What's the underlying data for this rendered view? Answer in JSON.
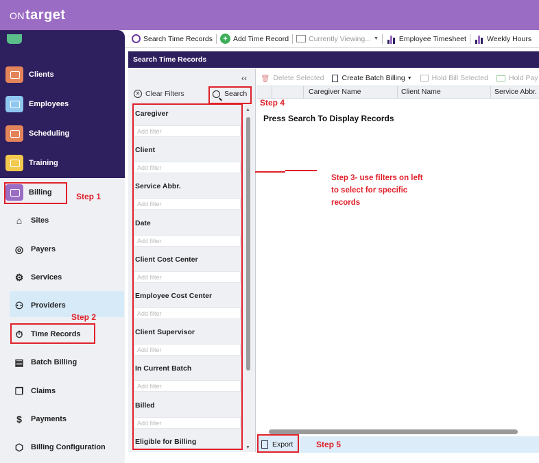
{
  "app": {
    "logo_prefix": "ON",
    "logo_main": "target"
  },
  "sidebar": {
    "dark_items": [
      {
        "label": "Clients",
        "color": "#e4845b"
      },
      {
        "label": "Employees",
        "color": "#8fc7f0"
      },
      {
        "label": "Scheduling",
        "color": "#e4845b"
      },
      {
        "label": "Training",
        "color": "#f2c94c"
      }
    ],
    "billing": {
      "label": "Billing",
      "color": "#9b6cc4"
    },
    "light_items": [
      {
        "label": "Sites",
        "icon": "building-icon"
      },
      {
        "label": "Payers",
        "icon": "payer-icon"
      },
      {
        "label": "Services",
        "icon": "wrench-icon"
      },
      {
        "label": "Providers",
        "icon": "providers-icon"
      },
      {
        "label": "Time Records",
        "icon": "stopwatch-icon"
      },
      {
        "label": "Batch Billing",
        "icon": "batch-icon"
      },
      {
        "label": "Claims",
        "icon": "claims-icon"
      },
      {
        "label": "Payments",
        "icon": "payment-icon"
      },
      {
        "label": "Billing Configuration",
        "icon": "config-icon"
      }
    ]
  },
  "toolbar": {
    "search_time_records": "Search Time Records",
    "add_time_record": "Add Time Record",
    "currently_viewing": "Currently Viewing...",
    "employee_timesheet": "Employee Timesheet",
    "weekly_hours": "Weekly Hours"
  },
  "panel": {
    "title": "Search Time Records"
  },
  "filters": {
    "clear_label": "Clear Filters",
    "search_label": "Search",
    "placeholder": "Add filter",
    "groups": [
      "Caregiver",
      "Client",
      "Service Abbr.",
      "Date",
      "Client Cost Center",
      "Employee Cost Center",
      "Client Supervisor",
      "In Current Batch",
      "Billed",
      "Eligible for Billing"
    ]
  },
  "grid": {
    "toolbar": {
      "delete_selected": "Delete Selected",
      "create_batch_billing": "Create Batch Billing",
      "hold_bill_selected": "Hold Bill Selected",
      "hold_pay": "Hold Pay"
    },
    "columns": [
      "Caregiver Name",
      "Client Name",
      "Service Abbr."
    ],
    "empty_message": "Press Search To Display Records",
    "export_label": "Export"
  },
  "annotations": {
    "step1": "Step 1",
    "step2": "Step 2",
    "step3": "Step 3- use filters on left to select for specific records",
    "step4": "Step 4",
    "step5": "Step 5"
  },
  "colors": {
    "topbar": "#9b6cc4",
    "sidebar_dark": "#2e1f5e",
    "annotation_red": "#e0202a",
    "selected_item": "#d7eaf8"
  }
}
